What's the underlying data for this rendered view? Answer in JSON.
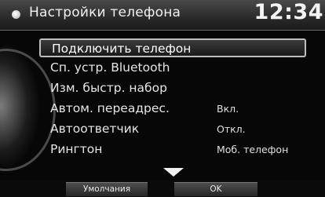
{
  "header": {
    "title": "Настройки телефона",
    "time": "12:34"
  },
  "menu": {
    "items": [
      {
        "label": "Подключить телефон",
        "value": "",
        "selected": true
      },
      {
        "label": "Сп. устр. Bluetooth",
        "value": ""
      },
      {
        "label": "Изм. быстр. набор",
        "value": ""
      },
      {
        "label": "Автом. переадрес.",
        "value": "Вкл."
      },
      {
        "label": "Автоответчик",
        "value": "Откл."
      },
      {
        "label": "Рингтон",
        "value": "Моб. телефон"
      }
    ]
  },
  "footer": {
    "default_label": "Умолчания",
    "ok_label": "OK"
  }
}
